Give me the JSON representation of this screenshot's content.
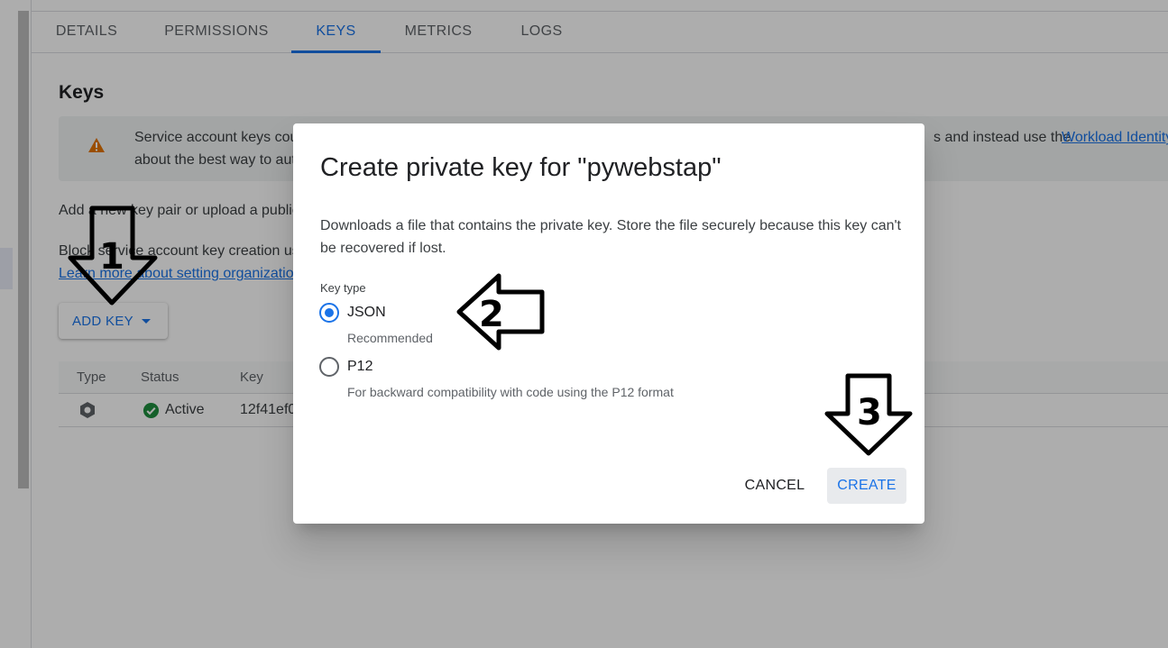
{
  "tabs": [
    {
      "label": "DETAILS"
    },
    {
      "label": "PERMISSIONS"
    },
    {
      "label": "KEYS"
    },
    {
      "label": "METRICS"
    },
    {
      "label": "LOGS"
    }
  ],
  "active_tab": "KEYS",
  "page": {
    "title": "Keys",
    "warning": {
      "line1": "Service account keys cou",
      "line1_end": "s and instead use the ",
      "link": "Workload Identity",
      "line2": "about the best way to aut"
    },
    "add_text": "Add a new key pair or upload a public",
    "block_text": "Block service account key creation us",
    "learn_link": "Learn more about setting organization",
    "add_key_button": "ADD KEY"
  },
  "table": {
    "columns": [
      "Type",
      "Status",
      "Key"
    ],
    "rows": [
      {
        "status": "Active",
        "key": "12f41ef0"
      }
    ]
  },
  "dialog": {
    "title": "Create private key for \"pywebstap\"",
    "description": "Downloads a file that contains the private key. Store the file securely because this key can't be recovered if lost.",
    "key_type_label": "Key type",
    "options": [
      {
        "label": "JSON",
        "hint": "Recommended",
        "selected": true
      },
      {
        "label": "P12",
        "hint": "For backward compatibility with code using the P12 format",
        "selected": false
      }
    ],
    "cancel_label": "CANCEL",
    "create_label": "CREATE"
  },
  "annotations": [
    "1",
    "2",
    "3"
  ],
  "colors": {
    "accent": "#1a73e8",
    "success": "#1e8e3e",
    "warning": "#e37400"
  }
}
